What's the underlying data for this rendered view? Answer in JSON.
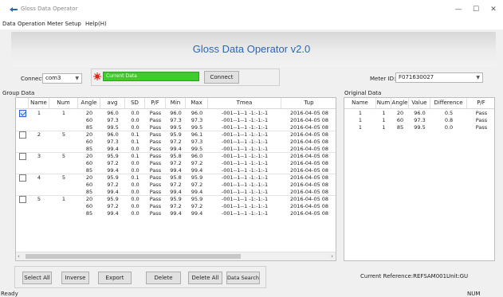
{
  "window": {
    "title": "Gloss Data Operator",
    "minimize_icon": "minimize-icon",
    "maximize_icon": "maximize-icon",
    "close_icon": "close-icon",
    "minimize_glyph": "—",
    "maximize_glyph": "☐",
    "close_glyph": "✕"
  },
  "menu": [
    "Data Operation",
    "Meter Setup",
    "Help(H)"
  ],
  "header": {
    "title": "Gloss Data Operator v2.0"
  },
  "connection": {
    "connect_label": "Connect",
    "port_value": "com3",
    "status_text": "Current Data",
    "connect_button": "Connect",
    "meter_id_label": "Meter ID:",
    "meter_id_value": "F071630027",
    "status_color": "#3ecc2d"
  },
  "group": {
    "title": "Group Data",
    "columns": [
      "Name",
      "Num",
      "Angle",
      "avg",
      "SD",
      "P/F",
      "Min",
      "Max",
      "Tmea",
      "Tup"
    ],
    "rows": [
      [
        "1",
        "1",
        "20",
        "96.0",
        "0.0",
        "Pass",
        "96.0",
        "96.0",
        "-001--1--1 -1:-1:-1",
        "2016-04-05 08"
      ],
      [
        "",
        "",
        "60",
        "97.3",
        "0.0",
        "Pass",
        "97.3",
        "97.3",
        "-001--1--1 -1:-1:-1",
        "2016-04-05 08"
      ],
      [
        "",
        "",
        "85",
        "99.5",
        "0.0",
        "Pass",
        "99.5",
        "99.5",
        "-001--1--1 -1:-1:-1",
        "2016-04-05 08"
      ],
      [
        "2",
        "5",
        "20",
        "96.0",
        "0.1",
        "Pass",
        "95.9",
        "96.1",
        "-001--1--1 -1:-1:-1",
        "2016-04-05 08"
      ],
      [
        "",
        "",
        "60",
        "97.3",
        "0.1",
        "Pass",
        "97.2",
        "97.3",
        "-001--1--1 -1:-1:-1",
        "2016-04-05 08"
      ],
      [
        "",
        "",
        "85",
        "99.4",
        "0.0",
        "Pass",
        "99.4",
        "99.5",
        "-001--1--1 -1:-1:-1",
        "2016-04-05 08"
      ],
      [
        "3",
        "5",
        "20",
        "95.9",
        "0.1",
        "Pass",
        "95.8",
        "96.0",
        "-001--1--1 -1:-1:-1",
        "2016-04-05 08"
      ],
      [
        "",
        "",
        "60",
        "97.2",
        "0.0",
        "Pass",
        "97.2",
        "97.2",
        "-001--1--1 -1:-1:-1",
        "2016-04-05 08"
      ],
      [
        "",
        "",
        "85",
        "99.4",
        "0.0",
        "Pass",
        "99.4",
        "99.4",
        "-001--1--1 -1:-1:-1",
        "2016-04-05 08"
      ],
      [
        "4",
        "5",
        "20",
        "95.9",
        "0.1",
        "Pass",
        "95.8",
        "95.9",
        "-001--1--1 -1:-1:-1",
        "2016-04-05 08"
      ],
      [
        "",
        "",
        "60",
        "97.2",
        "0.0",
        "Pass",
        "97.2",
        "97.2",
        "-001--1--1 -1:-1:-1",
        "2016-04-05 08"
      ],
      [
        "",
        "",
        "85",
        "99.4",
        "0.0",
        "Pass",
        "99.4",
        "99.4",
        "-001--1--1 -1:-1:-1",
        "2016-04-05 08"
      ],
      [
        "5",
        "1",
        "20",
        "95.9",
        "0.0",
        "Pass",
        "95.9",
        "95.9",
        "-001--1--1 -1:-1:-1",
        "2016-04-05 08"
      ],
      [
        "",
        "",
        "60",
        "97.2",
        "0.0",
        "Pass",
        "97.2",
        "97.2",
        "-001--1--1 -1:-1:-1",
        "2016-04-05 08"
      ],
      [
        "",
        "",
        "85",
        "99.4",
        "0.0",
        "Pass",
        "99.4",
        "99.4",
        "-001--1--1 -1:-1:-1",
        "2016-04-05 08"
      ]
    ],
    "checked": [
      true,
      false,
      false,
      false,
      false
    ],
    "scroll_left_glyph": "‹",
    "scroll_right_glyph": "›"
  },
  "original": {
    "title": "Original Data",
    "columns": [
      "Name",
      "Num",
      "Angle",
      "Value",
      "Difference",
      "P/F"
    ],
    "rows": [
      [
        "1",
        "1",
        "20",
        "96.0",
        "0.5",
        "Pass"
      ],
      [
        "1",
        "1",
        "60",
        "97.3",
        "0.8",
        "Pass"
      ],
      [
        "1",
        "1",
        "85",
        "99.5",
        "0.0",
        "Pass"
      ]
    ]
  },
  "buttons": [
    "Select All",
    "Inverse",
    "Export",
    "Delete",
    "Delete All",
    "Data Search"
  ],
  "footer": {
    "reference": "Current Reference:REFSAM001.",
    "unit": "Unit:GU"
  },
  "statusbar": {
    "left": "Ready",
    "right": "NUM"
  }
}
